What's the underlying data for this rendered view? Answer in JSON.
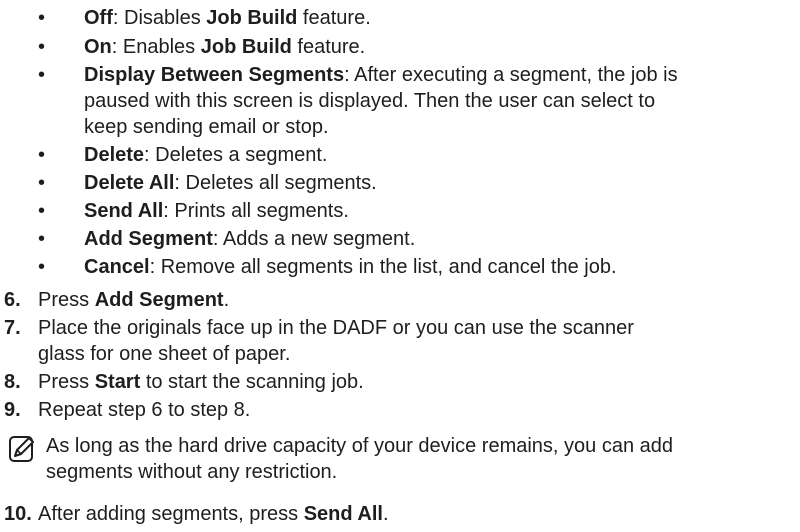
{
  "bullets": [
    {
      "term": "Off",
      "text": ": Disables ",
      "bold2": "Job Build",
      "tail": " feature."
    },
    {
      "term": "On",
      "text": ": Enables ",
      "bold2": "Job Build",
      "tail": " feature."
    },
    {
      "term": "Display Between Segments",
      "text": ": After executing a segment, the job is"
    },
    {
      "cont": "paused with this screen is displayed. Then the user can select to"
    },
    {
      "cont": "keep sending email or stop."
    },
    {
      "term": "Delete",
      "text": ": Deletes a segment."
    },
    {
      "term": "Delete All",
      "text": ": Deletes all segments."
    },
    {
      "term": "Send All",
      "text": ": Prints all segments."
    },
    {
      "term": "Add Segment",
      "text": ": Adds a new segment."
    },
    {
      "term": "Cancel",
      "text": ": Remove all segments in the list, and cancel the job."
    }
  ],
  "bullet_char": "•",
  "steps": {
    "s6": {
      "num": "6.",
      "pre": "Press ",
      "bold": "Add Segment",
      "post": "."
    },
    "s7": {
      "num": "7.",
      "line1": "Place the originals face up in the DADF or you can use the scanner",
      "line2": "glass for one sheet of paper."
    },
    "s8": {
      "num": "8.",
      "pre": "Press ",
      "bold": "Start",
      "post": " to start the scanning job."
    },
    "s9": {
      "num": "9.",
      "text": "Repeat step 6 to step 8."
    },
    "s10": {
      "num": "10.",
      "pre": "After adding segments, press ",
      "bold": "Send All",
      "post": "."
    }
  },
  "note": {
    "icon": "note-pencil-icon",
    "line1": "As long as the hard drive capacity of your device remains, you can add",
    "line2": "segments without any restriction."
  }
}
